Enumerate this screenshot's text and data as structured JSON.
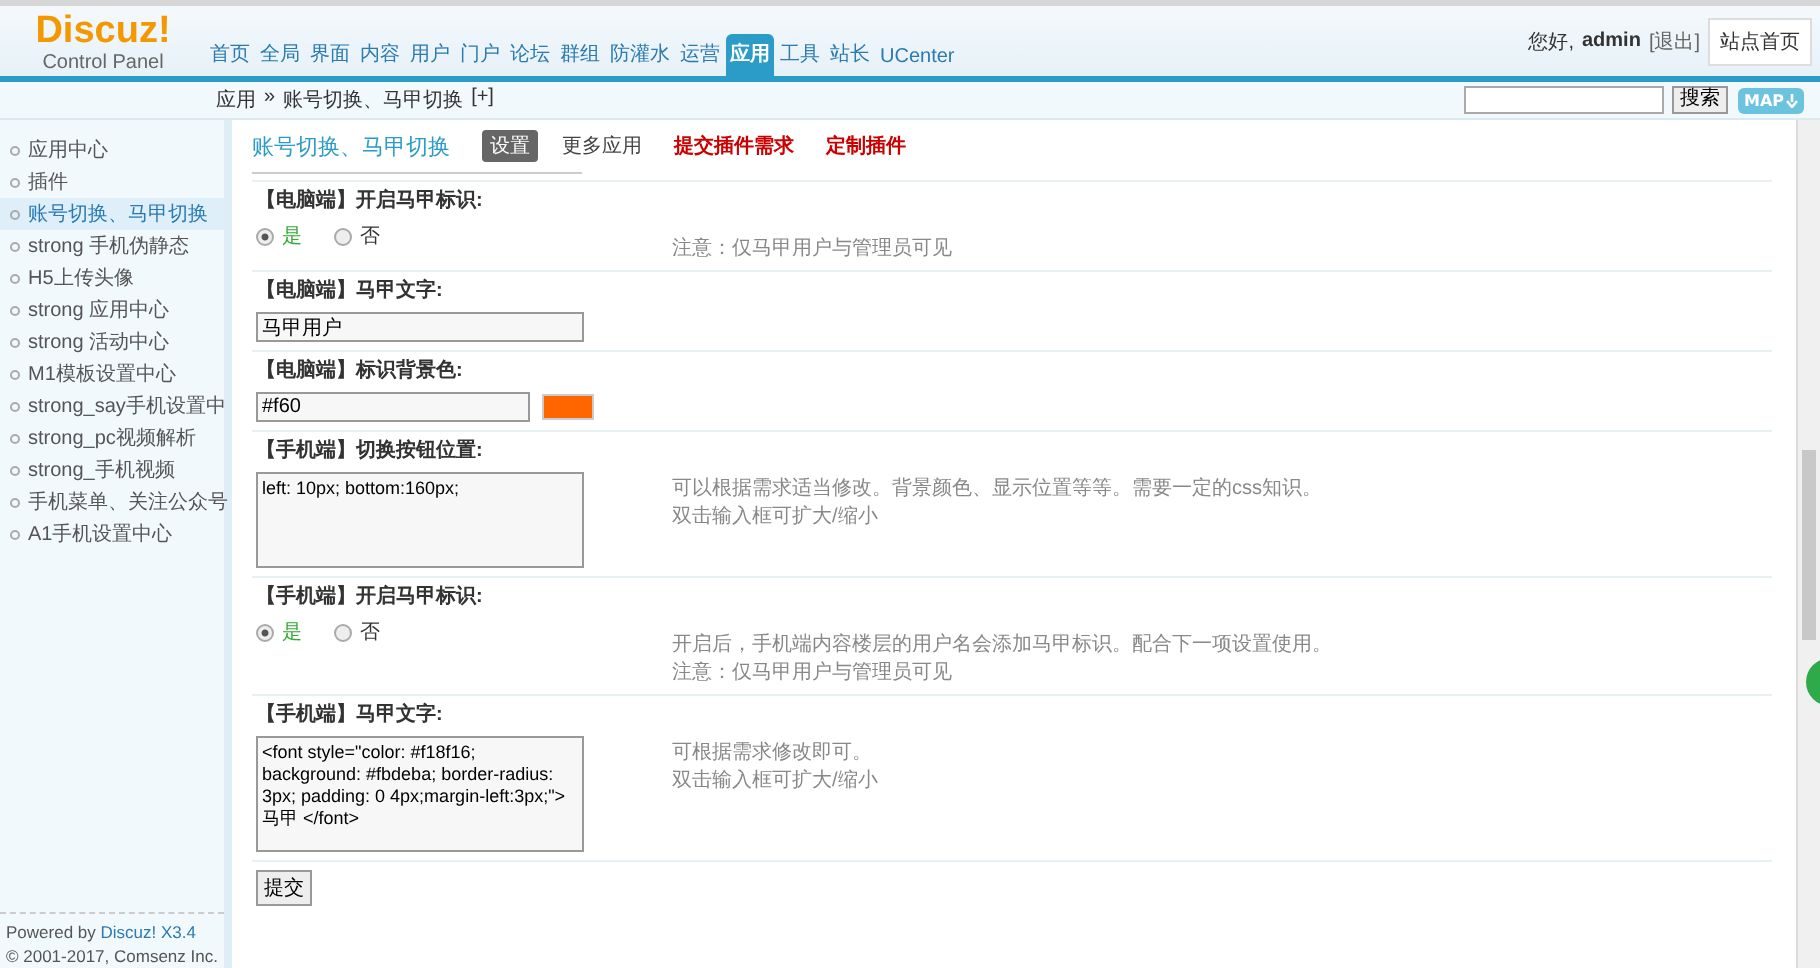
{
  "header": {
    "logo": {
      "title": "Discuz!",
      "subtitle": "Control Panel"
    },
    "nav": [
      {
        "label": "首页",
        "selected": false
      },
      {
        "label": "全局",
        "selected": false
      },
      {
        "label": "界面",
        "selected": false
      },
      {
        "label": "内容",
        "selected": false
      },
      {
        "label": "用户",
        "selected": false
      },
      {
        "label": "门户",
        "selected": false
      },
      {
        "label": "论坛",
        "selected": false
      },
      {
        "label": "群组",
        "selected": false
      },
      {
        "label": "防灌水",
        "selected": false
      },
      {
        "label": "运营",
        "selected": false
      },
      {
        "label": "应用",
        "selected": true
      },
      {
        "label": "工具",
        "selected": false
      },
      {
        "label": "站长",
        "selected": false
      },
      {
        "label": "UCenter",
        "selected": false
      }
    ],
    "greeting": "您好,",
    "user": "admin",
    "logout": "[退出]",
    "home_button": "站点首页"
  },
  "breadcrumb": {
    "items": [
      "应用",
      "账号切换、马甲切换"
    ],
    "separator": "»",
    "add": "[+]"
  },
  "search": {
    "button": "搜索",
    "map_button": "MAP"
  },
  "sidebar": {
    "items": [
      {
        "label": "应用中心",
        "selected": false
      },
      {
        "label": "插件",
        "selected": false
      },
      {
        "label": "账号切换、马甲切换",
        "selected": true
      },
      {
        "label": "strong 手机伪静态",
        "selected": false
      },
      {
        "label": "H5上传头像",
        "selected": false
      },
      {
        "label": "strong 应用中心",
        "selected": false
      },
      {
        "label": "strong 活动中心",
        "selected": false
      },
      {
        "label": "M1模板设置中心",
        "selected": false
      },
      {
        "label": "strong_say手机设置中",
        "selected": false
      },
      {
        "label": "strong_pc视频解析",
        "selected": false
      },
      {
        "label": "strong_手机视频",
        "selected": false
      },
      {
        "label": "手机菜单、关注公众号",
        "selected": false
      },
      {
        "label": "A1手机设置中心",
        "selected": false
      }
    ],
    "footer": {
      "powered": "Powered by",
      "link": "Discuz! X3.4",
      "copyright": "© 2001-2017, Comsenz Inc."
    }
  },
  "plugin": {
    "title": "账号切换、马甲切换",
    "tabs": [
      {
        "label": "设置",
        "kind": "tab",
        "selected": true
      },
      {
        "label": "更多应用",
        "kind": "tab",
        "selected": false
      },
      {
        "label": "提交插件需求",
        "kind": "link",
        "selected": false
      },
      {
        "label": "定制插件",
        "kind": "link",
        "selected": false
      }
    ]
  },
  "settings": [
    {
      "kind": "radio",
      "label": "【电脑端】开启马甲标识:",
      "options": [
        {
          "label": "是",
          "selected": true
        },
        {
          "label": "否",
          "selected": false
        }
      ],
      "comments": [
        "注意：仅马甲用户与管理员可见"
      ]
    },
    {
      "kind": "text",
      "label": "【电脑端】马甲文字:",
      "value": "马甲用户"
    },
    {
      "kind": "color",
      "label": "【电脑端】标识背景色:",
      "value": "#f60",
      "color": "#ff6600"
    },
    {
      "kind": "textarea",
      "label": "【手机端】切换按钮位置:",
      "value": "left: 10px; bottom:160px;",
      "comments": [
        "可以根据需求适当修改。背景颜色、显示位置等等。需要一定的css知识。",
        "双击输入框可扩大/缩小"
      ]
    },
    {
      "kind": "radio",
      "label": "【手机端】开启马甲标识:",
      "options": [
        {
          "label": "是",
          "selected": true
        },
        {
          "label": "否",
          "selected": false
        }
      ],
      "comments": [
        "开启后，手机端内容楼层的用户名会添加马甲标识。配合下一项设置使用。",
        "注意：仅马甲用户与管理员可见"
      ]
    },
    {
      "kind": "textarea",
      "label": "【手机端】马甲文字:",
      "value": "<font style=\"color: #f18f16; background: #fbdeba; border-radius: 3px; padding: 0 4px;margin-left:3px;\">马甲 </font>",
      "comments": [
        "可根据需求修改即可。",
        "双击输入框可扩大/缩小"
      ]
    }
  ],
  "submit": "提交"
}
